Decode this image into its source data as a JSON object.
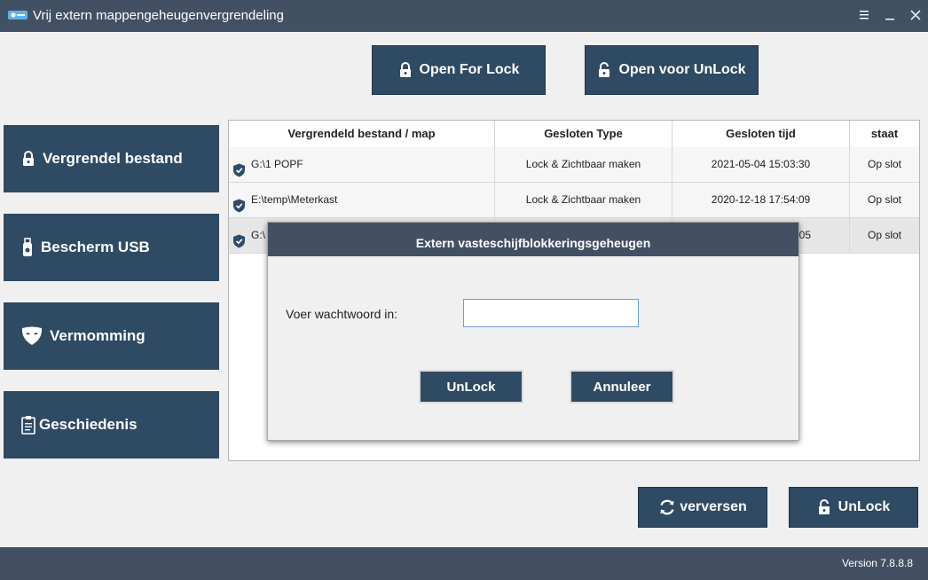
{
  "window": {
    "title": "Vrij extern mappengeheugenvergrendeling",
    "icons": [
      "usb-key-icon",
      "menu-icon",
      "minimize-icon",
      "close-icon"
    ]
  },
  "toolbar": {
    "open_lock_label": "Open For Lock",
    "open_unlock_label": "Open voor UnLock"
  },
  "sidebar": {
    "items": [
      {
        "label": "Vergrendel bestand",
        "icon": "lock-icon"
      },
      {
        "label": "Bescherm USB",
        "icon": "usb-icon"
      },
      {
        "label": "Vermomming",
        "icon": "mask-icon"
      },
      {
        "label": "Geschiedenis",
        "icon": "clipboard-icon"
      }
    ]
  },
  "table": {
    "headers": [
      "Vergrendeld bestand / map",
      "Gesloten Type",
      "Gesloten tijd",
      "staat"
    ],
    "rows": [
      {
        "path": "G:\\1 POPF",
        "type": "Lock & Zichtbaar maken",
        "time": "2021-05-04 15:03:30",
        "status": "Op slot"
      },
      {
        "path": "E:\\temp\\Meterkast",
        "type": "Lock & Zichtbaar maken",
        "time": "2020-12-18 17:54:09",
        "status": "Op slot"
      },
      {
        "path": "G:\\",
        "type": "",
        "time": "05",
        "status": "Op slot"
      }
    ]
  },
  "dialog": {
    "title": "Extern vasteschijfblokkeringsgeheugen",
    "password_label": "Voer wachtwoord in:",
    "password_value": "",
    "unlock_label": "UnLock",
    "cancel_label": "Annuleer"
  },
  "bottom": {
    "refresh_label": "verversen",
    "unlock_label": "UnLock"
  },
  "statusbar": {
    "version": "Version 7.8.8.8"
  },
  "colors": {
    "titlebar": "#425064",
    "button": "#2f4a63",
    "shield": "#2e4b6b"
  }
}
